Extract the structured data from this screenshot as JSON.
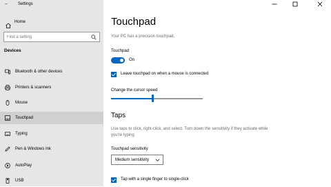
{
  "window": {
    "title": "Settings"
  },
  "sidebar": {
    "home_label": "Home",
    "search_placeholder": "Find a setting",
    "section_title": "Devices",
    "items": [
      {
        "label": "Bluetooth & other devices",
        "icon": "bluetooth-devices-icon"
      },
      {
        "label": "Printers & scanners",
        "icon": "printer-icon"
      },
      {
        "label": "Mouse",
        "icon": "mouse-icon"
      },
      {
        "label": "Touchpad",
        "icon": "touchpad-icon",
        "active": true
      },
      {
        "label": "Typing",
        "icon": "keyboard-icon"
      },
      {
        "label": "Pen & Windows Ink",
        "icon": "pen-icon"
      },
      {
        "label": "AutoPlay",
        "icon": "autoplay-icon"
      },
      {
        "label": "USB",
        "icon": "usb-icon"
      }
    ]
  },
  "main": {
    "title": "Touchpad",
    "subtitle": "Your PC has a precision touchpad.",
    "touchpad_label": "Touchpad",
    "touchpad_state": "On",
    "leave_touchpad_label": "Leave touchpad on when a mouse is connected",
    "cursor_speed_label": "Change the cursor speed",
    "cursor_speed_fraction": 0.44,
    "taps_heading": "Taps",
    "taps_description": "Use taps to click, right-click, and select. Turn down the sensitivity if they activate while you're typing",
    "sensitivity_label": "Touchpad sensitivity",
    "sensitivity_value": "Medium sensitivity",
    "tap_single_label": "Tap with a single finger to single-click"
  },
  "colors": {
    "accent": "#0067c0",
    "sidebar_bg": "#e6e6e6",
    "active_item_bg": "#d0d0d0"
  }
}
